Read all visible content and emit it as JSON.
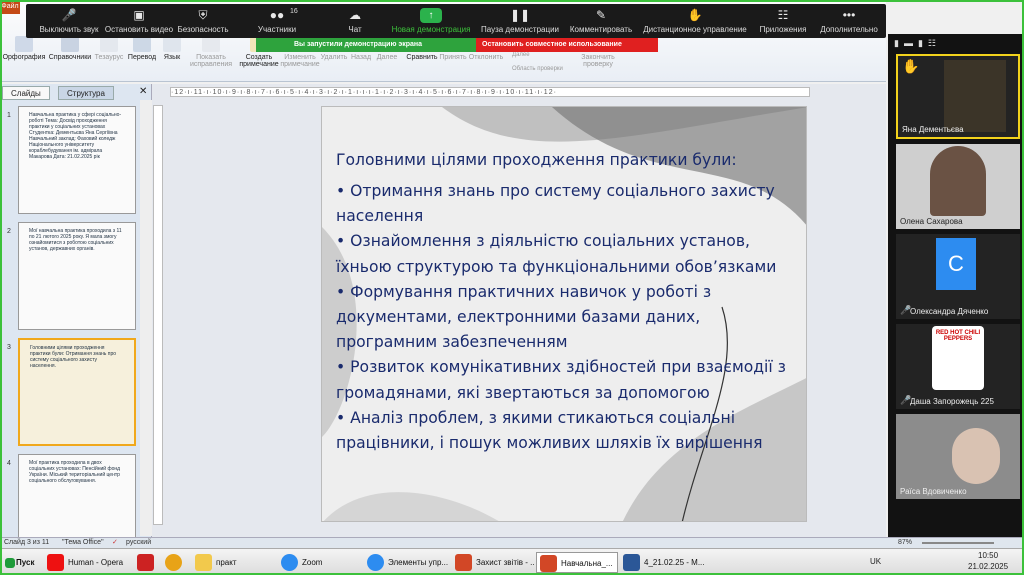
{
  "ribbon": {
    "file_tab": "Файл",
    "buttons": [
      "Орфография",
      "Справочники",
      "Тезаурус",
      "Перевод",
      "Язык",
      "Показать исправления",
      "Создать примечание",
      "Изменить примечание",
      "Удалить",
      "Назад",
      "Далее",
      "Сравнить",
      "Принять",
      "Отклонить",
      "Закончить проверку"
    ],
    "small": [
      "Далее",
      "Область проверки"
    ]
  },
  "zoom_toolbar": {
    "items": [
      "Выключить звук",
      "Остановить видео",
      "Безопасность",
      "Участники",
      "Чат",
      "Новая демонстрация",
      "Пауза демонстрации",
      "Комментировать",
      "Дистанционное управление",
      "Приложения",
      "Дополнительно"
    ],
    "participants_count": "16",
    "share_notice": "Вы запустили демонстрацию экрана",
    "stop_share": "Остановить совместное использование"
  },
  "panel": {
    "tabs": [
      "Слайды",
      "Структура"
    ],
    "thumbs": [
      {
        "num": "1",
        "text": "Навчальна практика у сфері соціально-роботі Тема: Досвід проходження практики у соціальних установах Студентка: Дементьєва Яна Сергіївна Навчальний заклад: Фаховий коледж Національного університету кораблебудування ім. адмірала Макарова Дата: 21.02.2025 рік"
      },
      {
        "num": "2",
        "text": "Мої навчальна практика проходила з 11 по 21 лютого 2025 року. Я мала змогу ознайомитися з роботою соціальних установ, державних органів."
      },
      {
        "num": "3",
        "text": "Головними цілями проходження практики були: Отримання знань про систему соціального захисту населення."
      },
      {
        "num": "4",
        "text": "Мої практика проходила в двох соціальних установах: Пенсійний фонд України. Міський територіальний центр соціального обслуговування."
      }
    ]
  },
  "ruler": "·12·ı·11·ı·10·ı·9·ı·8·ı·7·ı·6·ı·5·ı·4·ı·3·ı·2·ı·1·ı·ı·ı·1·ı·2·ı·3·ı·4·ı·5·ı·6·ı·7·ı·8·ı·9·ı·10·ı·11·ı·12·",
  "slide": {
    "title": "Головними цілями проходження практики були:",
    "bullets": [
      "• Отримання знань про систему соціального захисту населення",
      "• Ознайомлення з діяльністю соціальних установ, їхньою структурою та функціональними обов’язками",
      "• Формування практичних навичок у роботі з документами, електронними базами даних, програмним забезпеченням",
      "• Розвиток комунікативних здібностей при взаємодії з громадянами, які звертаються за допомогою",
      "• Аналіз проблем, з якими стикаються соціальні працівники, і пошук можливих шляхів їх вирішення"
    ]
  },
  "participants": [
    {
      "name": "Яна Дементьєва"
    },
    {
      "name": "Олена Сахарова"
    },
    {
      "name": "Олександра Дяченко",
      "initial": "C"
    },
    {
      "name": "Даша Запорожець 225",
      "logo": "RED HOT CHILI PEPPERS"
    },
    {
      "name": "Раїса Вдовиченко"
    }
  ],
  "status": {
    "slide": "Слайд 3 из 11",
    "theme": "\"Тема Office\"",
    "lang": "русский",
    "zoom": "87%"
  },
  "taskbar": {
    "start": "Пуск",
    "items": [
      "Human - Opera",
      "практ",
      "Zoom",
      "Элементы упр...",
      "Захист звітів - ...",
      "Навчальна_...",
      "4_21.02.25 - M..."
    ],
    "lang": "UK",
    "time": "10:50",
    "date": "21.02.2025"
  },
  "colors": {
    "accent_green": "#3cc13b",
    "stop_red": "#e02020",
    "slide_text": "#1a2b6d"
  }
}
